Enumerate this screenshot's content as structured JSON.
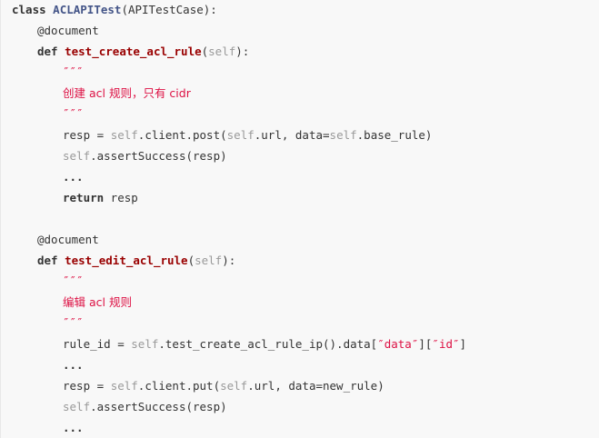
{
  "code": {
    "class_kw": "class",
    "class_name": "ACLAPITest",
    "class_base": "(APITestCase):",
    "deco1": "@document",
    "def1_kw": "def",
    "def1_name": "test_create_acl_rule",
    "def1_open": "(",
    "def1_self": "self",
    "def1_close": "):",
    "doc1_open": "″″″",
    "doc1_text": "创建 acl 规则，只有 cidr",
    "doc1_close": "″″″",
    "l7_a": "resp = ",
    "l7_self1": "self",
    "l7_b": ".client.post(",
    "l7_self2": "self",
    "l7_c": ".url, data=",
    "l7_self3": "self",
    "l7_d": ".base_rule)",
    "l8_self": "self",
    "l8_rest": ".assertSuccess(resp)",
    "l9": "...",
    "l10_kw": "return",
    "l10_rest": " resp",
    "deco2": "@document",
    "def2_kw": "def",
    "def2_name": "test_edit_acl_rule",
    "def2_open": "(",
    "def2_self": "self",
    "def2_close": "):",
    "doc2_open": "″″″",
    "doc2_text": "编辑 acl 规则",
    "doc2_close": "″″″",
    "l17_a": "rule_id = ",
    "l17_self": "self",
    "l17_b": ".test_create_acl_rule_ip().data[",
    "l17_s1": "″data″",
    "l17_c": "][",
    "l17_s2": "″id″",
    "l17_d": "]",
    "l18": "...",
    "l19_a": "resp = ",
    "l19_self1": "self",
    "l19_b": ".client.put(",
    "l19_self2": "self",
    "l19_c": ".url, data=new_rule)",
    "l20_self": "self",
    "l20_rest": ".assertSuccess(resp)",
    "l21": "..."
  }
}
